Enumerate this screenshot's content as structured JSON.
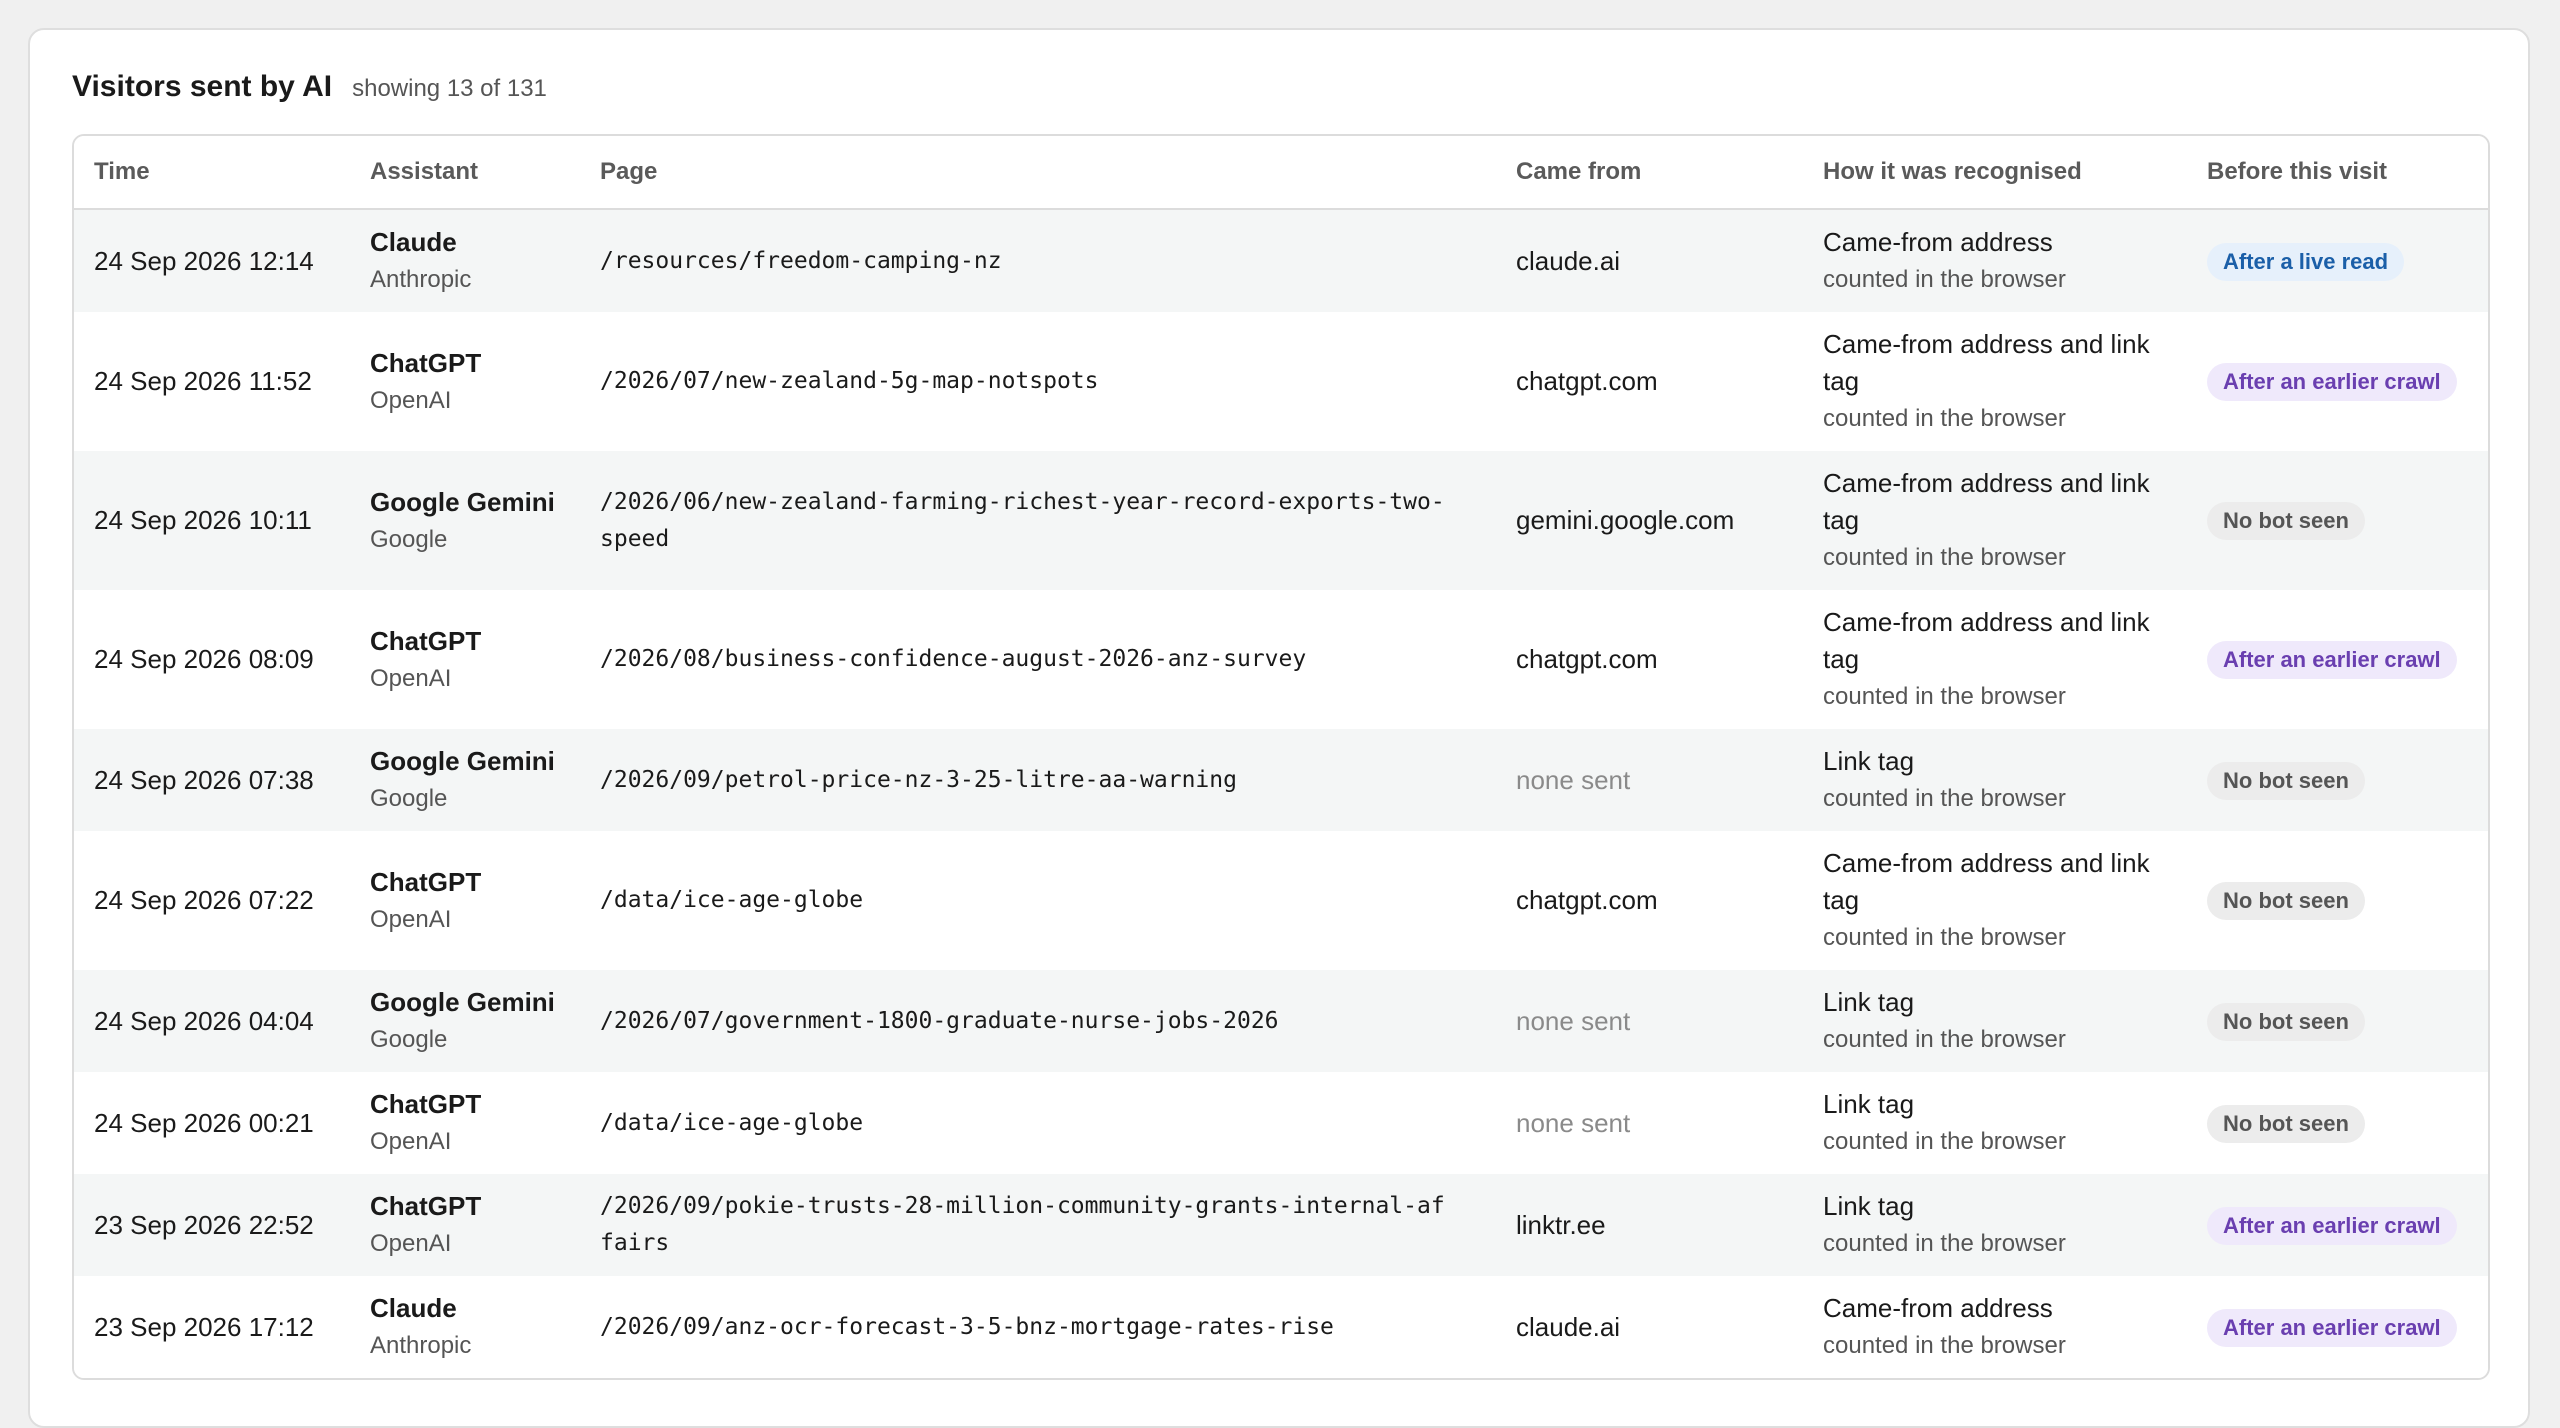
{
  "header": {
    "title": "Visitors sent by AI",
    "count": "showing 13 of 131"
  },
  "columns": {
    "time": "Time",
    "assistant": "Assistant",
    "page": "Page",
    "from": "Came from",
    "how": "How it was recognised",
    "before": "Before this visit"
  },
  "colors": {
    "badge_live": "#1b5fa8",
    "badge_crawl": "#6a3fb0",
    "badge_none": "#555555"
  },
  "rows": [
    {
      "time": "24 Sep 2026 12:14",
      "name": "Claude",
      "org": "Anthropic",
      "page": "/resources/freedom-camping-nz",
      "from": "claude.ai",
      "from_none": false,
      "how": "Came-from address",
      "how_sub": "counted in the browser",
      "before": "After a live read",
      "kind": "live"
    },
    {
      "time": "24 Sep 2026 11:52",
      "name": "ChatGPT",
      "org": "OpenAI",
      "page": "/2026/07/new-zealand-5g-map-notspots",
      "from": "chatgpt.com",
      "from_none": false,
      "how": "Came-from address and link tag",
      "how_sub": "counted in the browser",
      "before": "After an earlier crawl",
      "kind": "crawl"
    },
    {
      "time": "24 Sep 2026 10:11",
      "name": "Google Gemini",
      "org": "Google",
      "page": "/2026/06/new-zealand-farming-richest-year-record-exports-two-speed",
      "from": "gemini.google.com",
      "from_none": false,
      "how": "Came-from address and link tag",
      "how_sub": "counted in the browser",
      "before": "No bot seen",
      "kind": "none"
    },
    {
      "time": "24 Sep 2026 08:09",
      "name": "ChatGPT",
      "org": "OpenAI",
      "page": "/2026/08/business-confidence-august-2026-anz-survey",
      "from": "chatgpt.com",
      "from_none": false,
      "how": "Came-from address and link tag",
      "how_sub": "counted in the browser",
      "before": "After an earlier crawl",
      "kind": "crawl"
    },
    {
      "time": "24 Sep 2026 07:38",
      "name": "Google Gemini",
      "org": "Google",
      "page": "/2026/09/petrol-price-nz-3-25-litre-aa-warning",
      "from": "none sent",
      "from_none": true,
      "how": "Link tag",
      "how_sub": "counted in the browser",
      "before": "No bot seen",
      "kind": "none"
    },
    {
      "time": "24 Sep 2026 07:22",
      "name": "ChatGPT",
      "org": "OpenAI",
      "page": "/data/ice-age-globe",
      "from": "chatgpt.com",
      "from_none": false,
      "how": "Came-from address and link tag",
      "how_sub": "counted in the browser",
      "before": "No bot seen",
      "kind": "none"
    },
    {
      "time": "24 Sep 2026 04:04",
      "name": "Google Gemini",
      "org": "Google",
      "page": "/2026/07/government-1800-graduate-nurse-jobs-2026",
      "from": "none sent",
      "from_none": true,
      "how": "Link tag",
      "how_sub": "counted in the browser",
      "before": "No bot seen",
      "kind": "none"
    },
    {
      "time": "24 Sep 2026 00:21",
      "name": "ChatGPT",
      "org": "OpenAI",
      "page": "/data/ice-age-globe",
      "from": "none sent",
      "from_none": true,
      "how": "Link tag",
      "how_sub": "counted in the browser",
      "before": "No bot seen",
      "kind": "none"
    },
    {
      "time": "23 Sep 2026 22:52",
      "name": "ChatGPT",
      "org": "OpenAI",
      "page": "/2026/09/pokie-trusts-28-million-community-grants-internal-affairs",
      "from": "linktr.ee",
      "from_none": false,
      "how": "Link tag",
      "how_sub": "counted in the browser",
      "before": "After an earlier crawl",
      "kind": "crawl"
    },
    {
      "time": "23 Sep 2026 17:12",
      "name": "Claude",
      "org": "Anthropic",
      "page": "/2026/09/anz-ocr-forecast-3-5-bnz-mortgage-rates-rise",
      "from": "claude.ai",
      "from_none": false,
      "how": "Came-from address",
      "how_sub": "counted in the browser",
      "before": "After an earlier crawl",
      "kind": "crawl"
    }
  ]
}
